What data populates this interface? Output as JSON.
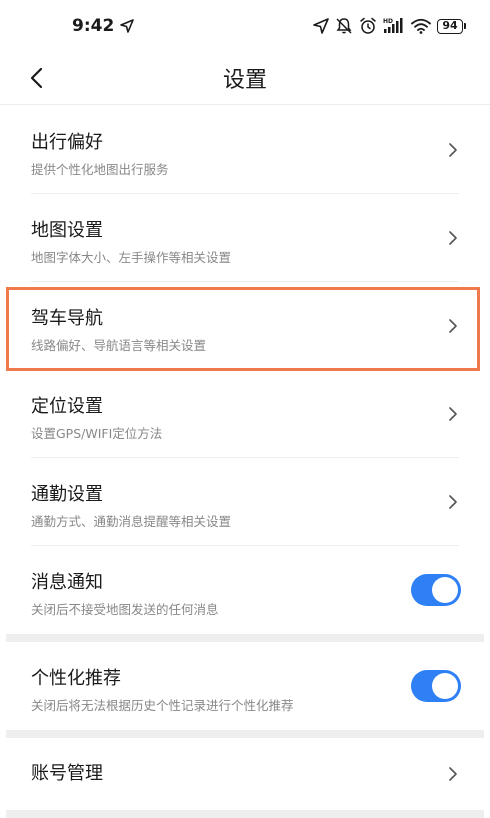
{
  "status_bar": {
    "time": "9:42",
    "battery": "94",
    "icons": [
      "location-arrow-icon",
      "mute-icon",
      "alarm-icon",
      "hd-signal-icon",
      "wifi-icon",
      "battery-icon"
    ]
  },
  "header": {
    "title": "设置",
    "back_icon": "back-chevron-icon"
  },
  "settings": [
    {
      "title": "出行偏好",
      "subtitle": "提供个性化地图出行服务",
      "control": "chevron"
    },
    {
      "title": "地图设置",
      "subtitle": "地图字体大小、左手操作等相关设置",
      "control": "chevron"
    },
    {
      "title": "驾车导航",
      "subtitle": "线路偏好、导航语言等相关设置",
      "control": "chevron",
      "highlighted": true
    },
    {
      "title": "定位设置",
      "subtitle": "设置GPS/WIFI定位方法",
      "control": "chevron"
    },
    {
      "title": "通勤设置",
      "subtitle": "通勤方式、通勤消息提醒等相关设置",
      "control": "chevron"
    },
    {
      "title": "消息通知",
      "subtitle": "关闭后不接受地图发送的任何消息",
      "control": "toggle",
      "on": true
    },
    {
      "title": "个性化推荐",
      "subtitle": "关闭后将无法根据历史个性记录进行个性化推荐",
      "control": "toggle",
      "on": true
    },
    {
      "title": "账号管理",
      "control": "chevron"
    }
  ],
  "colors": {
    "toggle_on": "#2f80f5",
    "highlight_border": "#f07a4b",
    "subtitle": "#888888"
  }
}
